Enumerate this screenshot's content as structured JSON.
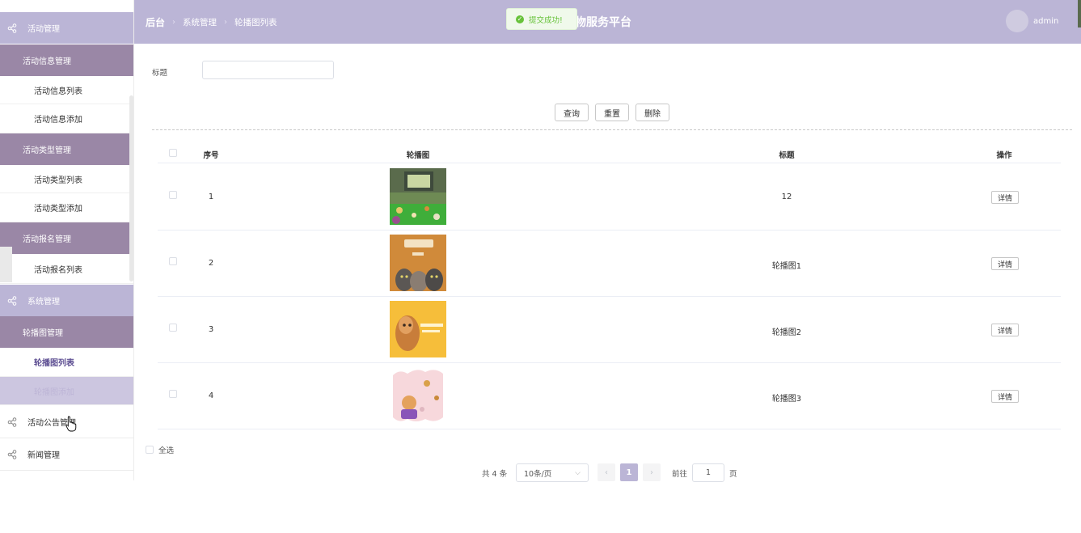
{
  "header": {
    "breadcrumb_root": "后台",
    "breadcrumb_1": "系统管理",
    "breadcrumb_2": "轮播图列表",
    "platform_title": "物服务平台",
    "username": "admin"
  },
  "toast": {
    "message": "提交成功!"
  },
  "sidebar": {
    "activity_mgmt": "活动管理",
    "activity_info_mgmt": "活动信息管理",
    "activity_info_list": "活动信息列表",
    "activity_info_add": "活动信息添加",
    "activity_type_mgmt": "活动类型管理",
    "activity_type_list": "活动类型列表",
    "activity_type_add": "活动类型添加",
    "activity_signup_mgmt": "活动报名管理",
    "activity_signup_list": "活动报名列表",
    "system_mgmt": "系统管理",
    "carousel_mgmt": "轮播图管理",
    "carousel_list": "轮播图列表",
    "carousel_add": "轮播图添加",
    "activity_notice_mgmt": "活动公告管理",
    "news_mgmt": "新闻管理"
  },
  "search": {
    "title_label": "标题",
    "title_value": ""
  },
  "buttons": {
    "query": "查询",
    "reset": "重置",
    "delete": "删除"
  },
  "table": {
    "headers": {
      "index": "序号",
      "image": "轮播图",
      "title": "标题",
      "action": "操作"
    },
    "rows": [
      {
        "index": "1",
        "title": "12",
        "action": "详情"
      },
      {
        "index": "2",
        "title": "轮播图1",
        "action": "详情"
      },
      {
        "index": "3",
        "title": "轮播图2",
        "action": "详情"
      },
      {
        "index": "4",
        "title": "轮播图3",
        "action": "详情"
      }
    ]
  },
  "select_all": "全选",
  "pagination": {
    "total": "共 4 条",
    "page_size": "10条/页",
    "current": "1",
    "goto_label": "前往",
    "goto_value": "1",
    "page_unit": "页"
  },
  "colors": {
    "accent": "#bbb5d6",
    "submenu": "#9a87a6",
    "success": "#67c23a"
  }
}
